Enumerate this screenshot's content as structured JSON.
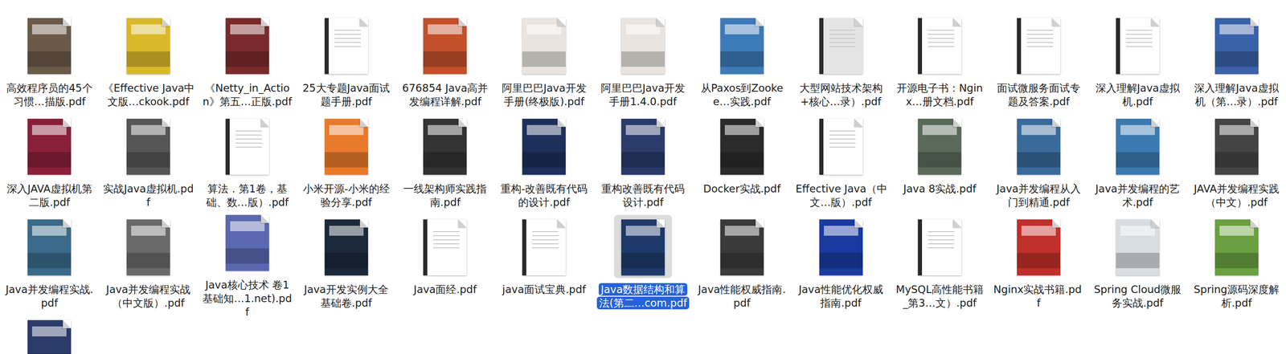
{
  "files": [
    {
      "name": "高效程序员的45个习惯…描版.pdf",
      "kind": "cover",
      "color": "#6b5a48",
      "selected": false
    },
    {
      "name": "《Effective Java中文版…ckook.pdf",
      "kind": "cover",
      "color": "#d9b92a",
      "selected": false
    },
    {
      "name": "《Netty_in_Action》第五…正版.pdf",
      "kind": "cover",
      "color": "#7a2a2a",
      "selected": false
    },
    {
      "name": "25大专题Java面试题手册.pdf",
      "kind": "page",
      "color": "#ffffff",
      "selected": false
    },
    {
      "name": "676854 Java高并发编程详解.pdf",
      "kind": "cover",
      "color": "#c4502a",
      "selected": false
    },
    {
      "name": "阿里巴巴Java开发手册(终极版).pdf",
      "kind": "cover",
      "color": "#e9e4df",
      "selected": false
    },
    {
      "name": "阿里巴巴Java开发手册1.4.0.pdf",
      "kind": "cover",
      "color": "#e9e4df",
      "selected": false
    },
    {
      "name": "从Paxos到Zookee…实践.pdf",
      "kind": "cover",
      "color": "#3d7ab8",
      "selected": false
    },
    {
      "name": "大型网站技术架构+核心…录）.pdf",
      "kind": "page",
      "color": "#e4e4e4",
      "selected": false
    },
    {
      "name": "开源电子书：Nginx…册文档.pdf",
      "kind": "page",
      "color": "#ffffff",
      "selected": false
    },
    {
      "name": "面试微服务面试专题及答案.pdf",
      "kind": "page",
      "color": "#ffffff",
      "selected": false
    },
    {
      "name": "深入理解Java虚拟机.pdf",
      "kind": "page",
      "color": "#ffffff",
      "selected": false
    },
    {
      "name": "深入理解Java虚拟机（第…录）.pdf",
      "kind": "cover",
      "color": "#3a62a8",
      "selected": false
    },
    {
      "name": "深入JAVA虚拟机第二版.pdf",
      "kind": "cover",
      "color": "#8a1f3a",
      "selected": false
    },
    {
      "name": "实战Java虚拟机.pdf",
      "kind": "cover",
      "color": "#555555",
      "selected": false
    },
    {
      "name": "算法．第1卷，基础、数…版）.pdf",
      "kind": "page",
      "color": "#ffffff",
      "selected": false
    },
    {
      "name": "小米开源-小米的经验分享.pdf",
      "kind": "cover",
      "color": "#e87a2a",
      "selected": false
    },
    {
      "name": "一线架构师实践指南.pdf",
      "kind": "cover",
      "color": "#333333",
      "selected": false
    },
    {
      "name": "重构-改善既有代码的设计.pdf",
      "kind": "cover",
      "color": "#1e2f5a",
      "selected": false
    },
    {
      "name": "重构改善既有代码设计.pdf",
      "kind": "cover",
      "color": "#2a3a6a",
      "selected": false
    },
    {
      "name": "Docker实战.pdf",
      "kind": "cover",
      "color": "#2b2b2b",
      "selected": false
    },
    {
      "name": "Effective Java（中文…版）.pdf",
      "kind": "page",
      "color": "#ffffff",
      "selected": false
    },
    {
      "name": "Java 8实战.pdf",
      "kind": "cover",
      "color": "#5a6a5a",
      "selected": false
    },
    {
      "name": "Java并发编程从入门到精通.pdf",
      "kind": "cover",
      "color": "#3a6a9a",
      "selected": false
    },
    {
      "name": "Java并发编程的艺术.pdf",
      "kind": "cover",
      "color": "#3a7ab0",
      "selected": false
    },
    {
      "name": "JAVA并发编程实践（中文）.pdf",
      "kind": "cover",
      "color": "#444444",
      "selected": false
    },
    {
      "name": "Java并发编程实战.pdf",
      "kind": "cover",
      "color": "#3a6a8a",
      "selected": false
    },
    {
      "name": "Java并发编程实战（中文版）.pdf",
      "kind": "cover",
      "color": "#6a6a6a",
      "selected": false
    },
    {
      "name": "Java核心技术 卷1基础知…1.net).pdf",
      "kind": "cover",
      "color": "#5a68b0",
      "selected": false
    },
    {
      "name": "Java开发实例大全 基础卷.pdf",
      "kind": "cover",
      "color": "#1a2a3a",
      "selected": false
    },
    {
      "name": "Java面经.pdf",
      "kind": "page",
      "color": "#ffffff",
      "selected": false
    },
    {
      "name": "java面试宝典.pdf",
      "kind": "page",
      "color": "#ffffff",
      "selected": false
    },
    {
      "name": "Java数据结构和算法(第二…com.pdf",
      "kind": "cover",
      "color": "#1e3a6a",
      "selected": true
    },
    {
      "name": "Java性能权威指南.pdf",
      "kind": "cover",
      "color": "#3a3a3a",
      "selected": false
    },
    {
      "name": "Java性能优化权威指南.pdf",
      "kind": "cover",
      "color": "#1a3aa0",
      "selected": false
    },
    {
      "name": "MySQL高性能书籍_第3…文）.pdf",
      "kind": "page",
      "color": "#ffffff",
      "selected": false
    },
    {
      "name": "Nginx实战书籍.pdf",
      "kind": "cover",
      "color": "#c0302a",
      "selected": false
    },
    {
      "name": "Spring Cloud微服务实战.pdf",
      "kind": "cover",
      "color": "#d8dde2",
      "selected": false
    },
    {
      "name": "Spring源码深度解析.pdf",
      "kind": "cover",
      "color": "#6aa040",
      "selected": false
    },
    {
      "name": "",
      "kind": "cover",
      "color": "#2a3a6a",
      "selected": false
    }
  ]
}
